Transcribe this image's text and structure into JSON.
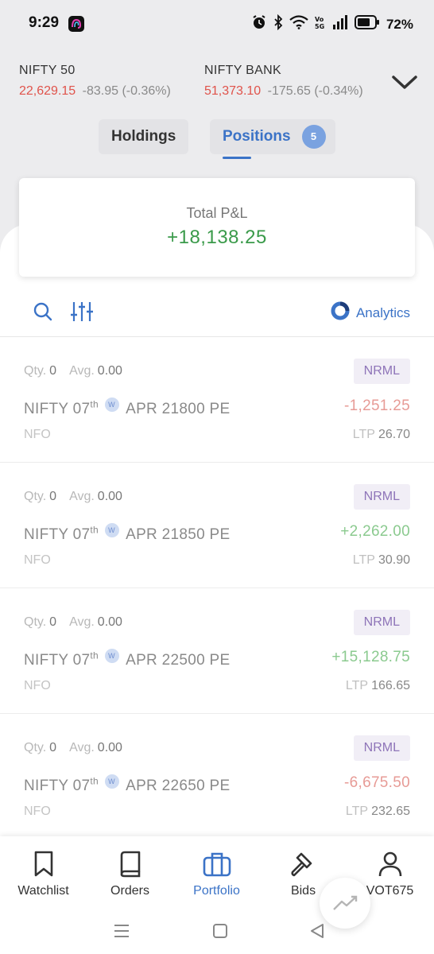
{
  "status_bar": {
    "time": "9:29",
    "battery_pct": "72%",
    "network_label": "Vo 5G"
  },
  "ticker": {
    "indices": [
      {
        "name": "NIFTY 50",
        "price": "22,629.15",
        "change": "-83.95 (-0.36%)"
      },
      {
        "name": "NIFTY BANK",
        "price": "51,373.10",
        "change": "-175.65 (-0.34%)"
      }
    ]
  },
  "tabs": {
    "holdings": "Holdings",
    "positions": "Positions",
    "positions_count": "5"
  },
  "total_pnl": {
    "label": "Total P&L",
    "value": "+18,138.25"
  },
  "toolbar": {
    "analytics_label": "Analytics"
  },
  "positions": [
    {
      "qty_label": "Qty.",
      "qty": "0",
      "avg_label": "Avg.",
      "avg": "0.00",
      "product": "NRML",
      "symbol": "NIFTY 07",
      "suffix": "th",
      "expiry_badge": "W",
      "contract": "APR 21800 PE",
      "pnl": "-1,251.25",
      "exchange": "NFO",
      "ltp_label": "LTP",
      "ltp": "26.70"
    },
    {
      "qty_label": "Qty.",
      "qty": "0",
      "avg_label": "Avg.",
      "avg": "0.00",
      "product": "NRML",
      "symbol": "NIFTY 07",
      "suffix": "th",
      "expiry_badge": "W",
      "contract": "APR 21850 PE",
      "pnl": "+2,262.00",
      "exchange": "NFO",
      "ltp_label": "LTP",
      "ltp": "30.90"
    },
    {
      "qty_label": "Qty.",
      "qty": "0",
      "avg_label": "Avg.",
      "avg": "0.00",
      "product": "NRML",
      "symbol": "NIFTY 07",
      "suffix": "th",
      "expiry_badge": "W",
      "contract": "APR 22500 PE",
      "pnl": "+15,128.75",
      "exchange": "NFO",
      "ltp_label": "LTP",
      "ltp": "166.65"
    },
    {
      "qty_label": "Qty.",
      "qty": "0",
      "avg_label": "Avg.",
      "avg": "0.00",
      "product": "NRML",
      "symbol": "NIFTY 07",
      "suffix": "th",
      "expiry_badge": "W",
      "contract": "APR 22650 PE",
      "pnl": "-6,675.50",
      "exchange": "NFO",
      "ltp_label": "LTP",
      "ltp": "232.65"
    }
  ],
  "bottom_nav": {
    "items": [
      {
        "label": "Watchlist",
        "icon": "bookmark-icon"
      },
      {
        "label": "Orders",
        "icon": "book-icon"
      },
      {
        "label": "Portfolio",
        "icon": "briefcase-icon"
      },
      {
        "label": "Bids",
        "icon": "gavel-icon"
      },
      {
        "label": "VOT675",
        "icon": "user-icon"
      }
    ]
  },
  "colors": {
    "accent": "#3b73c7",
    "loss": "#e0534b",
    "profit": "#3a9a4a",
    "product_badge": "#8e74b8"
  }
}
